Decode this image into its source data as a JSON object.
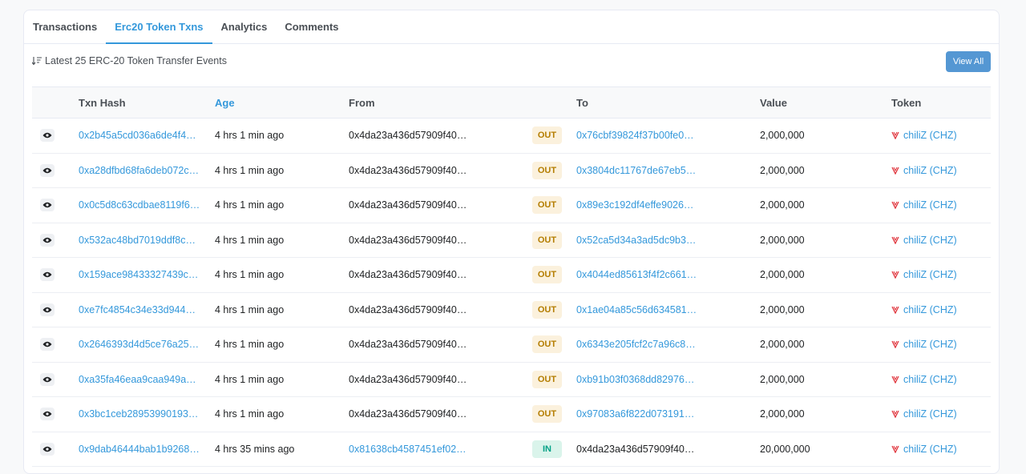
{
  "tabs": [
    {
      "label": "Transactions"
    },
    {
      "label": "Erc20 Token Txns"
    },
    {
      "label": "Analytics"
    },
    {
      "label": "Comments"
    }
  ],
  "subheader": {
    "text": "Latest 25 ERC-20 Token Transfer Events"
  },
  "view_all_label": "View All",
  "columns": {
    "hash": "Txn Hash",
    "age": "Age",
    "from": "From",
    "to": "To",
    "value": "Value",
    "token": "Token"
  },
  "rows": [
    {
      "hash": "0x2b45a5cd036a6de4f4…",
      "age": "4 hrs 1 min ago",
      "from": "0x4da23a436d57909f40…",
      "dir": "OUT",
      "to": "0x76cbf39824f37b00fe0…",
      "value": "2,000,000",
      "token": "chiliZ (CHZ)"
    },
    {
      "hash": "0xa28dfbd68fa6deb072c…",
      "age": "4 hrs 1 min ago",
      "from": "0x4da23a436d57909f40…",
      "dir": "OUT",
      "to": "0x3804dc11767de67eb5…",
      "value": "2,000,000",
      "token": "chiliZ (CHZ)"
    },
    {
      "hash": "0x0c5d8c63cdbae8119f6…",
      "age": "4 hrs 1 min ago",
      "from": "0x4da23a436d57909f40…",
      "dir": "OUT",
      "to": "0x89e3c192df4effe9026…",
      "value": "2,000,000",
      "token": "chiliZ (CHZ)"
    },
    {
      "hash": "0x532ac48bd7019ddf8c…",
      "age": "4 hrs 1 min ago",
      "from": "0x4da23a436d57909f40…",
      "dir": "OUT",
      "to": "0x52ca5d34a3ad5dc9b3…",
      "value": "2,000,000",
      "token": "chiliZ (CHZ)"
    },
    {
      "hash": "0x159ace98433327439c…",
      "age": "4 hrs 1 min ago",
      "from": "0x4da23a436d57909f40…",
      "dir": "OUT",
      "to": "0x4044ed85613f4f2c661…",
      "value": "2,000,000",
      "token": "chiliZ (CHZ)"
    },
    {
      "hash": "0xe7fc4854c34e33d944…",
      "age": "4 hrs 1 min ago",
      "from": "0x4da23a436d57909f40…",
      "dir": "OUT",
      "to": "0x1ae04a85c56d634581…",
      "value": "2,000,000",
      "token": "chiliZ (CHZ)"
    },
    {
      "hash": "0x2646393d4d5ce76a25…",
      "age": "4 hrs 1 min ago",
      "from": "0x4da23a436d57909f40…",
      "dir": "OUT",
      "to": "0x6343e205fcf2c7a96c8…",
      "value": "2,000,000",
      "token": "chiliZ (CHZ)"
    },
    {
      "hash": "0xa35fa46eaa9caa949a…",
      "age": "4 hrs 1 min ago",
      "from": "0x4da23a436d57909f40…",
      "dir": "OUT",
      "to": "0xb91b03f0368dd82976…",
      "value": "2,000,000",
      "token": "chiliZ (CHZ)"
    },
    {
      "hash": "0x3bc1ceb28953990193…",
      "age": "4 hrs 1 min ago",
      "from": "0x4da23a436d57909f40…",
      "dir": "OUT",
      "to": "0x97083a6f822d073191…",
      "value": "2,000,000",
      "token": "chiliZ (CHZ)"
    },
    {
      "hash": "0x9dab46444bab1b9268…",
      "age": "4 hrs 35 mins ago",
      "from": "0x81638cb4587451ef02…",
      "dir": "IN",
      "to": "0x4da23a436d57909f40…",
      "value": "20,000,000",
      "token": "chiliZ (CHZ)"
    }
  ],
  "colors": {
    "accent": "#3498db",
    "out_badge_bg": "#fbf1dd",
    "out_badge_text": "#b47d00",
    "in_badge_bg": "#daf4eb",
    "in_badge_text": "#00a186",
    "token_icon": "#e0353d"
  },
  "icons": {
    "sort": "sort-desc-icon",
    "row_preview": "eye-icon",
    "token": "chiliz-token-icon"
  }
}
